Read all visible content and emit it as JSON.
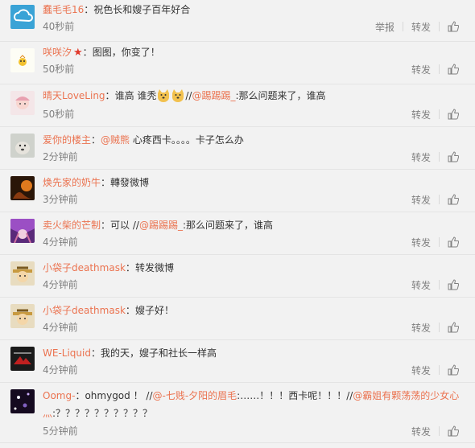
{
  "actions": {
    "report": "举报",
    "repost": "转发"
  },
  "comments": [
    {
      "user": "蠢毛毛16",
      "sep": "：",
      "text": "祝色长和嫂子百年好合",
      "time": "40秒前"
    },
    {
      "user": "咲咲汐",
      "sep": "：",
      "text": "图图，你变了！",
      "time": "50秒前"
    },
    {
      "user": "晴天LoveLing",
      "sep": "：",
      "text_a": "谁高 谁秃",
      "text_b": "//",
      "mention": "@踢踢踢_",
      "text_c": ":那么问题来了，谁高",
      "time": "50秒前"
    },
    {
      "user": "爱你的楼主",
      "sep": "：",
      "mention": "@贼熊",
      "text": " 心疼西卡。。。。卡子怎么办",
      "time": "2分钟前"
    },
    {
      "user": "焕先家的奶牛",
      "sep": "：",
      "text": "轉發微博",
      "time": "3分钟前"
    },
    {
      "user": "卖火柴的芒制",
      "sep": "：",
      "text_a": "可以 //",
      "mention": "@踢踢踢_",
      "text_b": ":那么问题来了，谁高",
      "time": "4分钟前"
    },
    {
      "user": "小袋子deathmask",
      "sep": "：",
      "text": "转发微博",
      "time": "4分钟前"
    },
    {
      "user": "小袋子deathmask",
      "sep": "：",
      "text": "嫂子好！",
      "time": "4分钟前"
    },
    {
      "user": "WE-Liquid",
      "sep": "：",
      "text": "我的天，嫂子和社长一样高",
      "time": "4分钟前"
    },
    {
      "user": "Oomg-",
      "sep": "：",
      "text_a": "ohmygod ！ //",
      "mention": "@-七贱-夕阳的眉毛",
      "text_b": ":……！！！西卡呢！！！//",
      "mention2": "@霸姐有颗荡荡的少女心",
      "mention3": "灬",
      "text_c": ":？？？？？？？？？？",
      "time": "5分钟前"
    }
  ]
}
